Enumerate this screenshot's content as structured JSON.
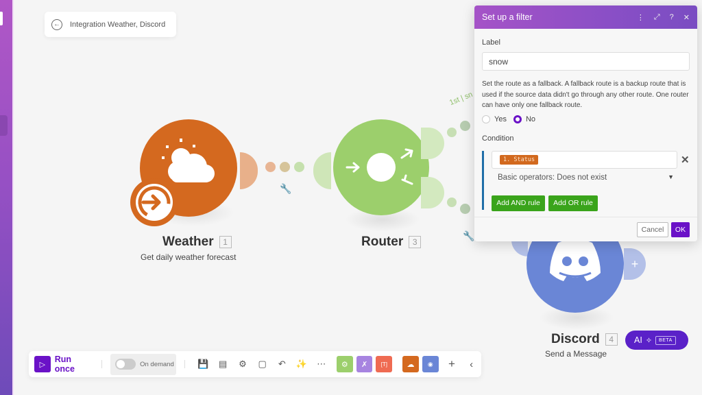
{
  "scenario": {
    "title": "Integration Weather, Discord",
    "back_icon": "arrow-left-circle-icon"
  },
  "modules": [
    {
      "name": "Weather",
      "number": "1",
      "subtitle": "Get daily weather forecast",
      "color": "#d4691f",
      "icon": "sun-cloud-icon",
      "trigger_icon": "arrow-right-circle-icon"
    },
    {
      "name": "Router",
      "number": "3",
      "subtitle": "",
      "color": "#9ccf6c",
      "icon": "router-icon"
    },
    {
      "name": "Discord",
      "number": "4",
      "subtitle": "Send a Message",
      "color": "#6a86d6",
      "icon": "discord-icon"
    }
  ],
  "route_label": "1st | sn",
  "filter_panel": {
    "title": "Set up a filter",
    "header_icons": [
      "more-vertical-icon",
      "expand-icon",
      "help-icon",
      "close-icon"
    ],
    "label_heading": "Label",
    "label_value": "snow",
    "fallback_help": "Set the route as a fallback. A fallback route is a backup route that is used if the source data didn't go through any other route. One router can have only one fallback route.",
    "fallback_options": [
      {
        "label": "Yes",
        "selected": false
      },
      {
        "label": "No",
        "selected": true
      }
    ],
    "condition_heading": "Condition",
    "condition_token": "1. Status",
    "operator": "Basic operators: Does not exist",
    "add_and_label": "Add AND rule",
    "add_or_label": "Add OR rule",
    "cancel_label": "Cancel",
    "ok_label": "OK"
  },
  "toolbar": {
    "run_label": "Run once",
    "schedule_label": "On demand",
    "schedule_enabled": false,
    "icons": [
      "save-icon",
      "scenario-io-icon",
      "settings-icon",
      "notes-icon",
      "undo-icon",
      "auto-align-icon",
      "more-icon"
    ],
    "tools": [
      {
        "name": "tools",
        "color": "#9ccf6c"
      },
      {
        "name": "flow-control",
        "color": "#a784e0"
      },
      {
        "name": "text-parser",
        "color": "#ef6b52"
      }
    ],
    "favorites": [
      {
        "name": "weather",
        "color": "#d4691f"
      },
      {
        "name": "discord",
        "color": "#6a86d6"
      }
    ]
  },
  "ai_button": {
    "label": "AI",
    "badge": "BETA"
  },
  "colors": {
    "accent": "#6a12c7",
    "green_button": "#3aa41b",
    "filter_header": "#8a4fc6"
  }
}
